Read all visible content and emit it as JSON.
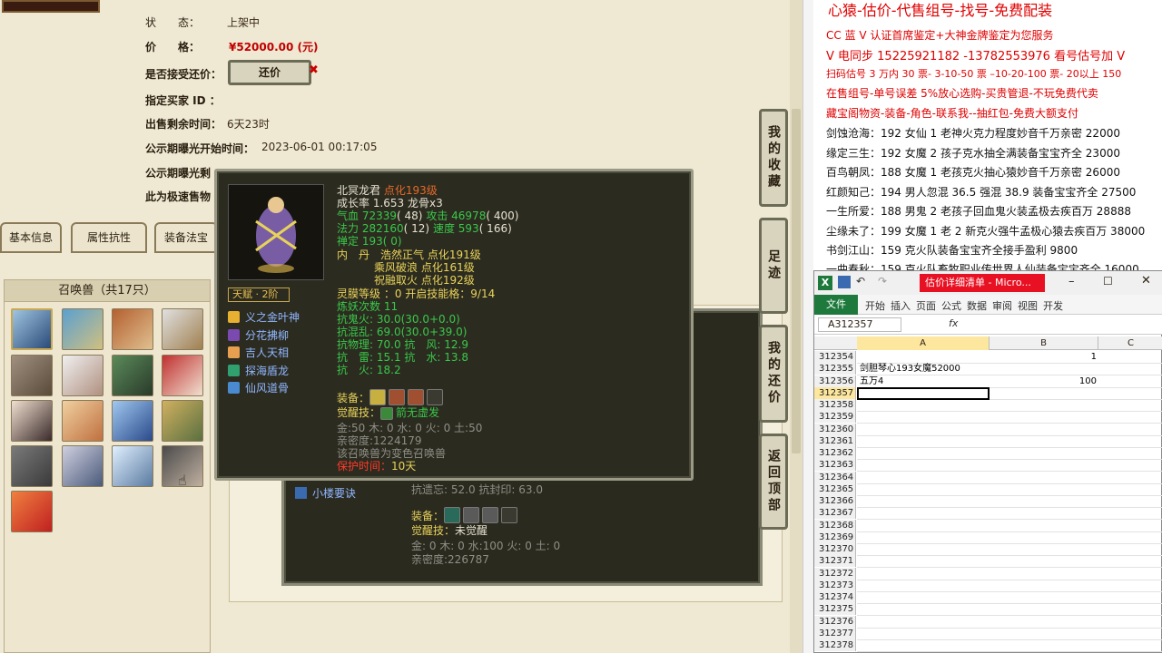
{
  "listing": {
    "status_label": "状　　态：",
    "status_value": "上架中",
    "price_label": "价　　格：",
    "price_value": "¥52000.00 (元)",
    "haggle_label": "是否接受还价：",
    "haggle_button": "还价",
    "haggle_close": "✖",
    "buyer_id_label": "指定买家 ID ：",
    "remaining_label": "出售剩余时间：",
    "remaining_value": "6天23时",
    "public_start_label": "公示期曝光开始时间：",
    "public_start_value": "2023-06-01 00:17:05",
    "public_end_label": "公示期曝光剩",
    "fast_label": "此为极速售物"
  },
  "tabs": [
    "基本信息",
    "属性抗性",
    "装备法宝"
  ],
  "pet_panel": {
    "header": "召唤兽（共17只）",
    "count": 17
  },
  "tooltip": {
    "name": "北冥龙君",
    "name_tag": "点化193级",
    "growth": "成长率 1.653 龙骨x3",
    "hp_label": "气血",
    "hp_value": "72339",
    "hp_extra": "( 48)",
    "atk_label": "攻击",
    "atk_value": "46978",
    "atk_extra": "( 400)",
    "mp_label": "法力",
    "mp_value": "282160",
    "mp_extra": "( 12)",
    "spd_label": "速度",
    "spd_value": "593",
    "spd_extra": "( 166)",
    "zen": "禅定 193( 0)",
    "inner_label": "内　丹",
    "inner_1": "浩然正气 点化191级",
    "inner_2": "乘风破浪 点化161级",
    "inner_3": "祝融取火 点化192级",
    "talent": "天赋 · 2阶",
    "skills": [
      "义之金叶神",
      "分花拂柳",
      "吉人天相",
      "探海盾龙",
      "仙风道骨"
    ],
    "spirit": "灵膜等级 ：0 开启技能格：9/14",
    "refine": "炼妖次数 11",
    "res_ghost": "抗鬼火: 30.0(30.0+0.0)",
    "res_chaos": "抗混乱: 69.0(30.0+39.0)",
    "res_phys": "抗物理: 70.0 抗　风: 12.9",
    "res_thunder": "抗　雷: 15.1 抗　水: 13.8",
    "res_fire": "抗　火: 18.2",
    "equip_label": "装备：",
    "awaken_label": "觉醒技：",
    "awaken_value": "箭无虚发",
    "elements": "金:50 木: 0 水: 0 火: 0 土:50",
    "intimacy": "亲密度:1224179",
    "variant_note": "该召唤兽为变色召唤兽",
    "protect_label": "保护时间：",
    "protect_value": "10天"
  },
  "second_panel": {
    "skill": "小楼要诀",
    "res_line": "抗遗忘: 52.0 抗封印: 63.0",
    "equip_label": "装备：",
    "awaken_label": "觉醒技：",
    "awaken_value": "未觉醒",
    "elements": "金: 0 木: 0 水:100 火: 0 土: 0",
    "intimacy": "亲密度:226787"
  },
  "side_buttons": [
    "我的收藏",
    "足迹",
    "我的还价",
    "返回顶部"
  ],
  "ad": {
    "title": "心猿-估价-代售组号-找号-免费配装",
    "lines": [
      "CC 蓝 V 认证首席鉴定+大神金牌鉴定为您服务",
      "V 电同步 15225921182 -13782553976 看号估号加 V",
      "扫码估号 3 万内 30 票- 3-10-50 票 –10-20-100 票- 20以上 150",
      "在售组号-单号误差 5%放心选购-买贵管退-不玩免费代卖",
      "藏宝阁物资-装备-角色-联系我--抽红包-免费大额支付"
    ],
    "listings": [
      "剑蚀沧海：192 女仙 1 老神火克力程度妙音千万亲密 22000",
      "缘定三生：192 女魔 2 孩子克水抽全满装备宝宝齐全 23000",
      "百鸟朝凤：188 女魔 1 老孩克火抽心猿妙音千万亲密 26000",
      "红颜知己：194 男人忽混 36.5 强混 38.9 装备宝宝齐全 27500",
      "一生所爱：188 男鬼 2 老孩子回血鬼火装孟极去疾百万 28888",
      "尘缘未了：199 女魔 1 老 2 新克火强牛孟极心猿去疾百万 38000",
      "书剑江山：159 克火队装备宝宝齐全接手盈利 9800",
      "一曲春秋：159 克火队畜牧职业传世界人仙装备宝宝齐全 16000"
    ]
  },
  "excel": {
    "app_icon": "excel-icon",
    "title": "估价详细清单 - Micro...",
    "ribbon": [
      "文件",
      "开始",
      "插入",
      "页面",
      "公式",
      "数据",
      "审阅",
      "视图",
      "开发"
    ],
    "name_box": "A312357",
    "fx": "fx",
    "columns": [
      "A",
      "B",
      "C"
    ],
    "rows": [
      {
        "n": "312354",
        "a": "",
        "b": "1",
        "c": ""
      },
      {
        "n": "312355",
        "a": "剑胆琴心193女魔52000",
        "b": "",
        "c": ""
      },
      {
        "n": "312356",
        "a": "五万4",
        "b": "100",
        "c": ""
      },
      {
        "n": "312357",
        "a": "",
        "b": "",
        "c": ""
      },
      {
        "n": "312358",
        "a": "",
        "b": "",
        "c": ""
      },
      {
        "n": "312359",
        "a": "",
        "b": "",
        "c": ""
      },
      {
        "n": "312360",
        "a": "",
        "b": "",
        "c": ""
      },
      {
        "n": "312361",
        "a": "",
        "b": "",
        "c": ""
      },
      {
        "n": "312362",
        "a": "",
        "b": "",
        "c": ""
      },
      {
        "n": "312363",
        "a": "",
        "b": "",
        "c": ""
      },
      {
        "n": "312364",
        "a": "",
        "b": "",
        "c": ""
      },
      {
        "n": "312365",
        "a": "",
        "b": "",
        "c": ""
      },
      {
        "n": "312366",
        "a": "",
        "b": "",
        "c": ""
      },
      {
        "n": "312367",
        "a": "",
        "b": "",
        "c": ""
      },
      {
        "n": "312368",
        "a": "",
        "b": "",
        "c": ""
      },
      {
        "n": "312369",
        "a": "",
        "b": "",
        "c": ""
      },
      {
        "n": "312370",
        "a": "",
        "b": "",
        "c": ""
      },
      {
        "n": "312371",
        "a": "",
        "b": "",
        "c": ""
      },
      {
        "n": "312372",
        "a": "",
        "b": "",
        "c": ""
      },
      {
        "n": "312373",
        "a": "",
        "b": "",
        "c": ""
      },
      {
        "n": "312374",
        "a": "",
        "b": "",
        "c": ""
      },
      {
        "n": "312375",
        "a": "",
        "b": "",
        "c": ""
      },
      {
        "n": "312376",
        "a": "",
        "b": "",
        "c": ""
      },
      {
        "n": "312377",
        "a": "",
        "b": "",
        "c": ""
      },
      {
        "n": "312378",
        "a": "",
        "b": "",
        "c": ""
      }
    ]
  },
  "colors": {
    "price": "#c00000",
    "tooltip_bg": "#2c2b20",
    "green_stat": "#39c84a",
    "orange_tag": "#e36a2a",
    "ad_red": "#e00000",
    "excel_green": "#1e7a3c",
    "excel_close_red": "#e81123"
  }
}
